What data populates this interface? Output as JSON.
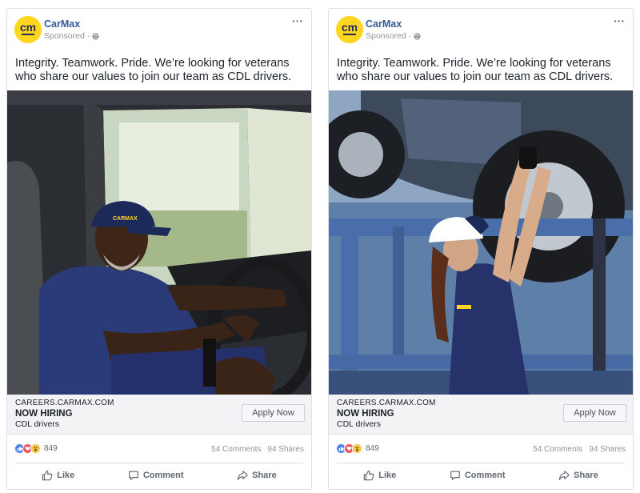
{
  "posts": [
    {
      "page_name": "CarMax",
      "avatar_text": "cm",
      "sponsored": "Sponsored",
      "separator": "·",
      "text": "Integrity. Teamwork. Pride. We’re looking for veterans who share our values to join our team as CDL drivers.",
      "photo_icon": "truck-driver-photo",
      "link": {
        "domain": "CAREERS.CARMAX.COM",
        "title": "NOW HIRING",
        "description": "CDL drivers",
        "cta": "Apply Now"
      },
      "reactions_count": "849",
      "comments": "54 Comments",
      "shares": "94 Shares",
      "actions": {
        "like": "Like",
        "comment": "Comment",
        "share": "Share"
      }
    },
    {
      "page_name": "CarMax",
      "avatar_text": "cm",
      "sponsored": "Sponsored",
      "separator": "·",
      "text": "Integrity. Teamwork. Pride. We’re looking for veterans who share our values to join our team as CDL drivers.",
      "photo_icon": "car-hauler-photo",
      "link": {
        "domain": "CAREERS.CARMAX.COM",
        "title": "NOW HIRING",
        "description": "CDL drivers",
        "cta": "Apply Now"
      },
      "reactions_count": "849",
      "comments": "54 Comments",
      "shares": "94 Shares",
      "actions": {
        "like": "Like",
        "comment": "Comment",
        "share": "Share"
      }
    }
  ],
  "colors": {
    "brand_yellow": "#ffd520",
    "brand_navy": "#1c2a5a",
    "link_blue": "#365899",
    "like_blue": "#4f7ff0",
    "love_red": "#f2545b",
    "wow_yellow": "#f7c748"
  }
}
